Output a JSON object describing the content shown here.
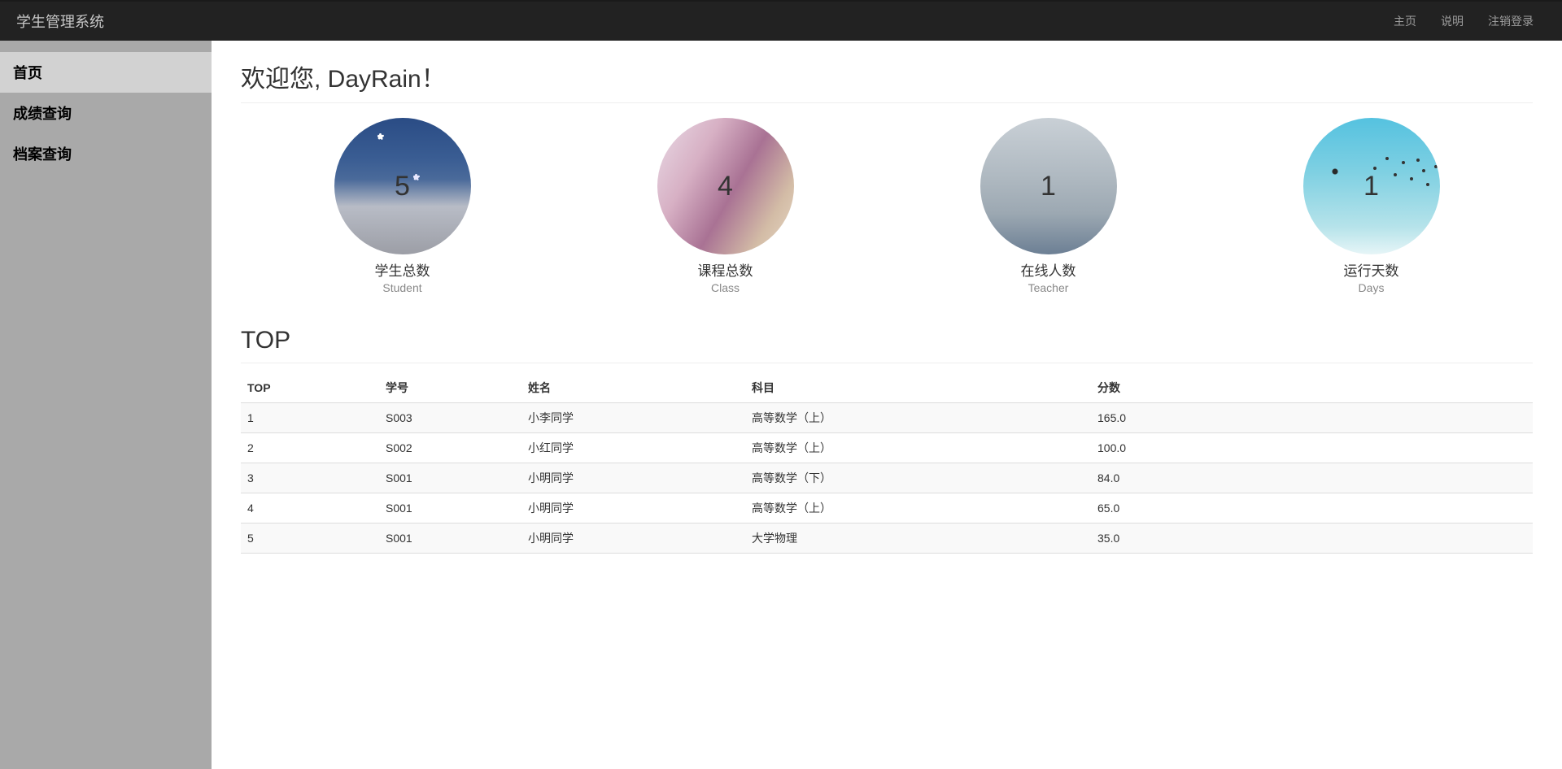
{
  "header": {
    "brand": "学生管理系统",
    "links": [
      {
        "label": "主页"
      },
      {
        "label": "说明"
      },
      {
        "label": "注销登录"
      }
    ]
  },
  "sidebar": {
    "items": [
      {
        "label": "首页",
        "active": true
      },
      {
        "label": "成绩查询",
        "active": false
      },
      {
        "label": "档案查询",
        "active": false
      }
    ]
  },
  "welcome": "欢迎您, DayRain！",
  "cards": [
    {
      "count": "5",
      "title": "学生总数",
      "sub": "Student"
    },
    {
      "count": "4",
      "title": "课程总数",
      "sub": "Class"
    },
    {
      "count": "1",
      "title": "在线人数",
      "sub": "Teacher"
    },
    {
      "count": "1",
      "title": "运行天数",
      "sub": "Days"
    }
  ],
  "top_section_title": "TOP",
  "table": {
    "headers": [
      "TOP",
      "学号",
      "姓名",
      "科目",
      "分数"
    ],
    "rows": [
      [
        "1",
        "S003",
        "小李同学",
        "高等数学（上）",
        "165.0"
      ],
      [
        "2",
        "S002",
        "小红同学",
        "高等数学（上）",
        "100.0"
      ],
      [
        "3",
        "S001",
        "小明同学",
        "高等数学（下）",
        "84.0"
      ],
      [
        "4",
        "S001",
        "小明同学",
        "高等数学（上）",
        "65.0"
      ],
      [
        "5",
        "S001",
        "小明同学",
        "大学物理",
        "35.0"
      ]
    ]
  }
}
